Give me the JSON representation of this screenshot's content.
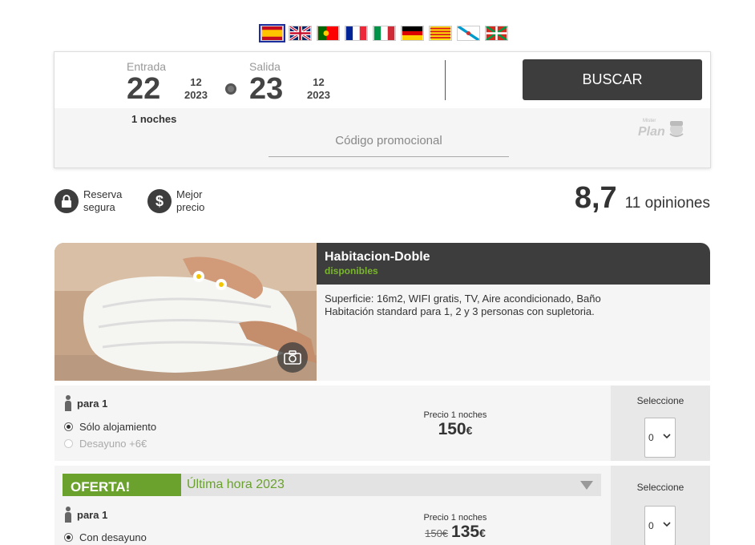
{
  "languages": [
    {
      "code": "es",
      "icon": "spain-flag-icon",
      "active": true
    },
    {
      "code": "en",
      "icon": "uk-flag-icon",
      "active": false
    },
    {
      "code": "pt",
      "icon": "portugal-flag-icon",
      "active": false
    },
    {
      "code": "fr",
      "icon": "france-flag-icon",
      "active": false
    },
    {
      "code": "it",
      "icon": "italy-flag-icon",
      "active": false
    },
    {
      "code": "de",
      "icon": "germany-flag-icon",
      "active": false
    },
    {
      "code": "ca",
      "icon": "catalonia-flag-icon",
      "active": false
    },
    {
      "code": "gl",
      "icon": "galicia-flag-icon",
      "active": false
    },
    {
      "code": "eu",
      "icon": "basque-flag-icon",
      "active": false
    }
  ],
  "search": {
    "checkin": {
      "label": "Entrada",
      "day": "22",
      "month": "12",
      "year": "2023"
    },
    "checkout": {
      "label": "Salida",
      "day": "23",
      "month": "12",
      "year": "2023"
    },
    "nights": "1 noches",
    "button": "BUSCAR",
    "promo_placeholder": "Código promocional",
    "logo_text_top": "Mister",
    "logo_text": "Plan"
  },
  "badges": {
    "secure": {
      "line1": "Reserva",
      "line2": "segura",
      "icon": "lock-icon"
    },
    "best_price": {
      "line1": "Mejor",
      "line2": "precio",
      "icon": "dollar-icon"
    }
  },
  "rating": {
    "score": "8,7",
    "opinions": "11 opiniones"
  },
  "room": {
    "title": "Habitacion-Doble",
    "availability": "disponibles",
    "features": "Superficie: 16m2,  WIFI gratis, TV, Aire acondicionado, Baño",
    "description": "Habitación standard para 1, 2 y 3 personas con supletoria."
  },
  "rates": [
    {
      "persons": "para 1",
      "options": [
        {
          "label": "Sólo alojamiento",
          "checked": true,
          "disabled": false
        },
        {
          "label": "Desayuno +6€",
          "checked": false,
          "disabled": true
        }
      ],
      "price_label": "Precio 1 noches",
      "price": "150",
      "currency": "€",
      "select_label": "Seleccione",
      "select_value": "0"
    },
    {
      "offer_tag": "OFERTA!",
      "offer_name": "Última hora 2023",
      "persons": "para 1",
      "options": [
        {
          "label": "Con desayuno",
          "checked": true,
          "disabled": false
        }
      ],
      "price_label": "Precio 1 noches",
      "old_price": "150€",
      "price": "135",
      "currency": "€",
      "select_label": "Seleccione",
      "select_value": "0"
    }
  ]
}
